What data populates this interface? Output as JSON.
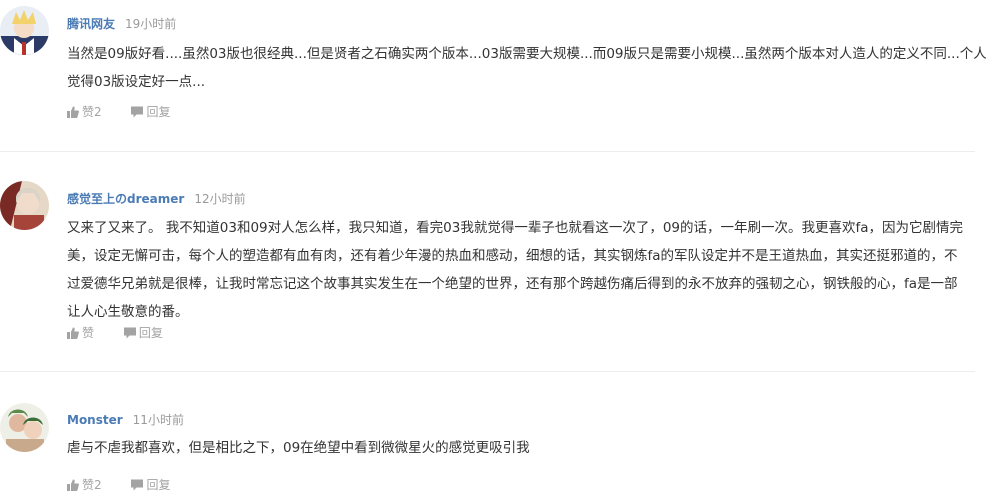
{
  "comments": [
    {
      "username": "腾讯网友",
      "time": "19小时前",
      "lines": [
        "当然是09版好看....虽然03版也很经典...但是贤者之石确实两个版本...03版需要大规模...而09版只是需要小规模...虽然两个版本对人造人的定义不同...个人",
        "觉得03版设定好一点..."
      ],
      "like_label": "赞2",
      "reply_label": "回复",
      "avatar_colors": [
        "#2b3a66",
        "#f2d36b"
      ]
    },
    {
      "username": "感觉至上のdreamer",
      "time": "12小时前",
      "lines": [
        "又来了又来了。 我不知道03和09对人怎么样，我只知道，看完03我就觉得一辈子也就看这一次了，09的话，一年刷一次。我更喜欢fa，因为它剧情完",
        "美，设定无懈可击，每个人的塑造都有血有肉，还有着少年漫的热血和感动，细想的话，其实钢炼fa的军队设定并不是王道热血，其实还挺邪道的，不",
        "过爱德华兄弟就是很棒，让我时常忘记这个故事其实发生在一个绝望的世界，还有那个跨越伤痛后得到的永不放弃的强韧之心，钢铁般的心，fa是一部",
        "让人心生敬意的番。"
      ],
      "like_label": "赞",
      "reply_label": "回复",
      "avatar_colors": [
        "#7a2a24",
        "#e8d2b8"
      ]
    },
    {
      "username": "Monster",
      "time": "11小时前",
      "lines": [
        "虐与不虐我都喜欢，但是相比之下，09在绝望中看到微微星火的感觉更吸引我"
      ],
      "like_label": "赞2",
      "reply_label": "回复",
      "avatar_colors": [
        "#5e8a4a",
        "#e0b8a0"
      ]
    }
  ]
}
